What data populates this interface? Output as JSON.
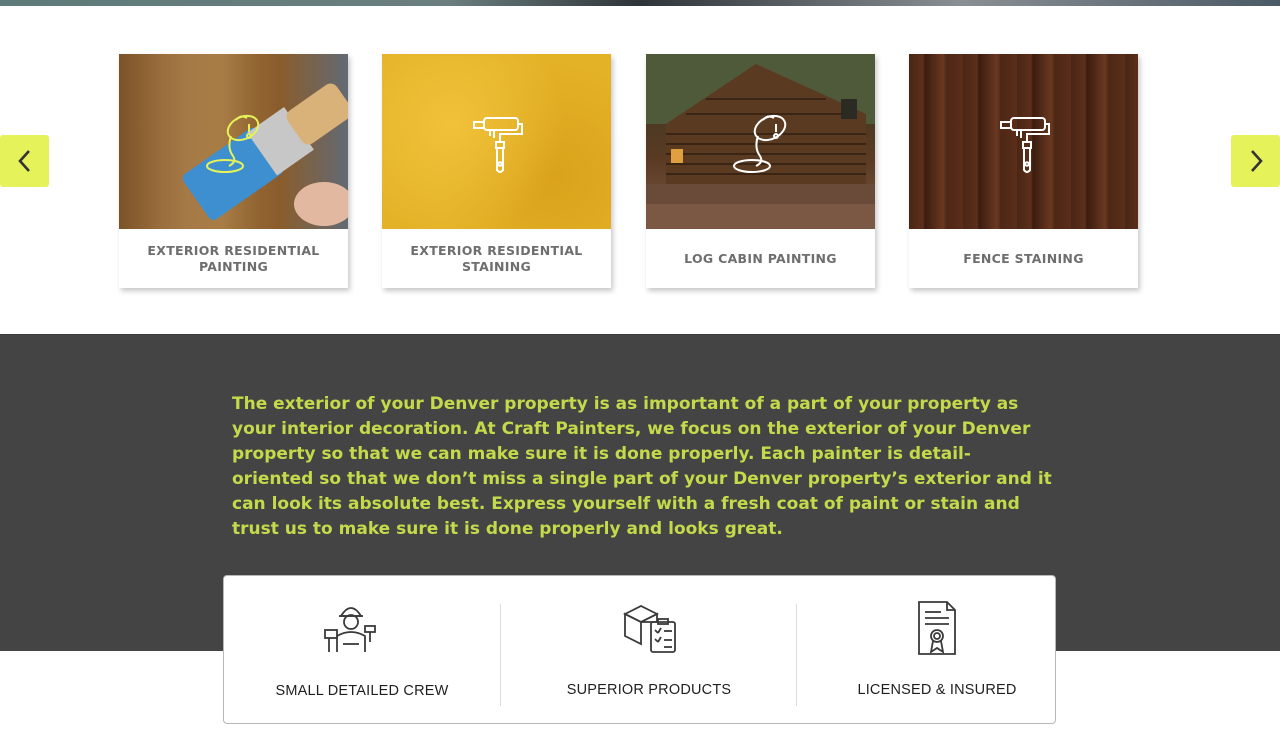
{
  "carousel": {
    "prev_icon": "chevron-left-icon",
    "next_icon": "chevron-right-icon",
    "arrow_color": "#e6f25a",
    "cards": [
      {
        "title": "EXTERIOR RESIDENTIAL PAINTING",
        "icon": "paint-bucket-pour-icon",
        "icon_color": "#e6f25a"
      },
      {
        "title": "EXTERIOR RESIDENTIAL STAINING",
        "icon": "paint-roller-icon",
        "icon_color": "#ffffff"
      },
      {
        "title": "LOG CABIN PAINTING",
        "icon": "paint-bucket-pour-icon",
        "icon_color": "#ffffff"
      },
      {
        "title": "FENCE STAINING",
        "icon": "paint-roller-icon",
        "icon_color": "#ffffff"
      }
    ]
  },
  "intro": {
    "text": "The exterior of your Denver property is as important of a part of your property as your interior decoration. At Craft Painters, we focus on the exterior of your Denver property so that we can make sure it is done properly. Each painter is detail-oriented so that we don’t miss a single part of your Denver property’s exterior and it can look its absolute best. Express yourself with a fresh coat of paint or stain and trust us to make sure it is done properly and looks great.",
    "text_color": "#c5da4a",
    "background": "#444444"
  },
  "features": [
    {
      "label": "SMALL DETAILED CREW",
      "icon": "painter-worker-icon"
    },
    {
      "label": "SUPERIOR PRODUCTS",
      "icon": "box-checklist-icon"
    },
    {
      "label": "LICENSED & INSURED",
      "icon": "certificate-icon"
    }
  ]
}
